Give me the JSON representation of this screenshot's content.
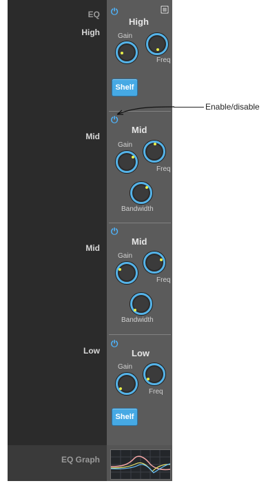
{
  "header": {
    "section": "EQ"
  },
  "bands": [
    {
      "side_label": "High",
      "title": "High",
      "gain": "Gain",
      "freq": "Freq",
      "shelf": "Shelf"
    },
    {
      "side_label": "Mid",
      "title": "Mid",
      "gain": "Gain",
      "freq": "Freq",
      "bandwidth": "Bandwidth"
    },
    {
      "side_label": "Mid",
      "title": "Mid",
      "gain": "Gain",
      "freq": "Freq",
      "bandwidth": "Bandwidth"
    },
    {
      "side_label": "Low",
      "title": "Low",
      "gain": "Gain",
      "freq": "Freq",
      "shelf": "Shelf"
    }
  ],
  "footer": {
    "label": "EQ Graph"
  },
  "annotation": {
    "text": "Enable/disable"
  },
  "icons": {
    "power": "power-icon",
    "menu": "menu-icon"
  },
  "colors": {
    "accent": "#4db5ff",
    "button": "#46a9e4",
    "knob_ring": "#55b3e8",
    "indicator": "#eaf04a"
  }
}
